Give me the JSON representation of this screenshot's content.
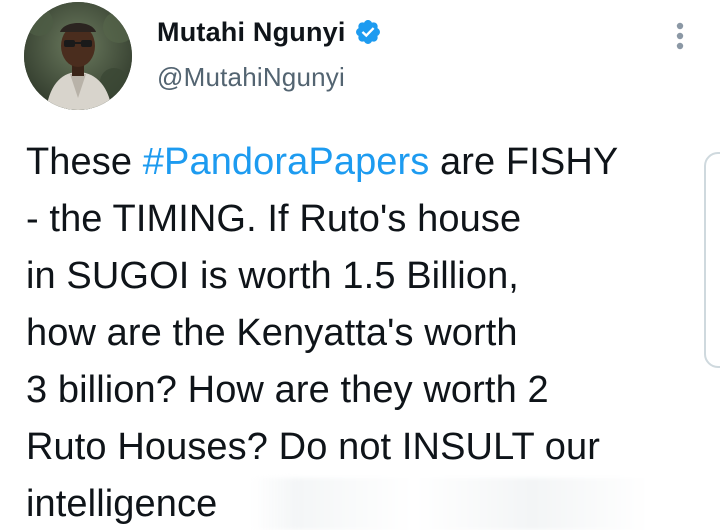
{
  "tweet": {
    "author": {
      "display_name": "Mutahi Ngunyi",
      "handle": "@MutahiNgunyi",
      "verified": true,
      "avatar_icon": "profile-photo"
    },
    "menu_icon": "more-vertical-icon",
    "text_lines": [
      {
        "before": "These ",
        "hashtag": "#PandoraPapers",
        "after": " are FISHY"
      },
      {
        "text": "- the TIMING. If Ruto's house"
      },
      {
        "text": "in SUGOI is worth 1.5 Billion,"
      },
      {
        "text": "how are the Kenyatta's worth"
      },
      {
        "text": "3 billion? How are they worth 2"
      },
      {
        "text": "Ruto Houses? Do not INSULT our"
      },
      {
        "text": "intelligence"
      }
    ]
  },
  "colors": {
    "text": "#0f1419",
    "secondary": "#536471",
    "accent": "#1d9bf0"
  }
}
